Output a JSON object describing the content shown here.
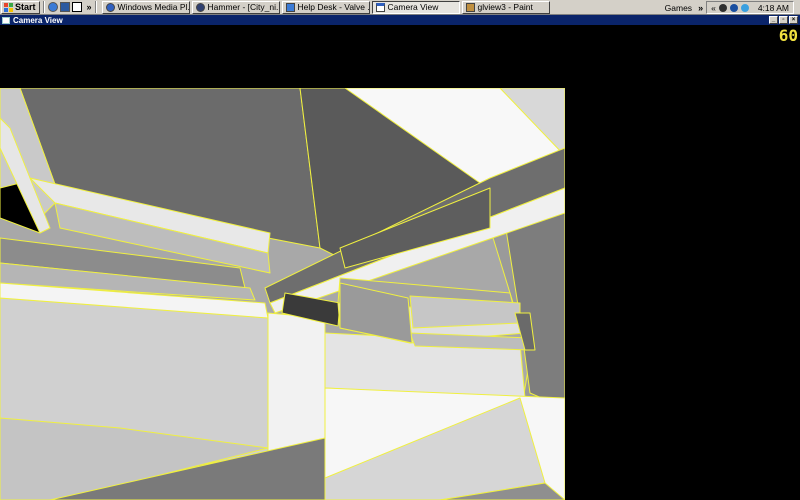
{
  "taskbar": {
    "start_label": "Start",
    "quick_launch_overflow": "»",
    "tasks": [
      {
        "label": "Windows Media Pl...",
        "icon": "media-player-icon",
        "color": "#3060c0"
      },
      {
        "label": "Hammer - [City_ni...",
        "icon": "hammer-icon",
        "color": "#304070"
      },
      {
        "label": "Help Desk - Valve ...",
        "icon": "ie-icon",
        "color": "#3b7bd6"
      },
      {
        "label": "Camera View",
        "icon": "window-icon",
        "color": "#ffffff",
        "active": true
      },
      {
        "label": "glview3 - Paint",
        "icon": "paint-icon",
        "color": "#c09040"
      }
    ],
    "tray": {
      "toolbar_label": "Games",
      "toolbar_overflow": "»",
      "tray_overflow": "«",
      "clock": "4:18 AM"
    }
  },
  "window": {
    "title": "Camera View",
    "fps_counter": "60"
  },
  "colors": {
    "edge_highlight": "#f0f040",
    "title_bar": "#0a246a",
    "background": "#000000"
  }
}
